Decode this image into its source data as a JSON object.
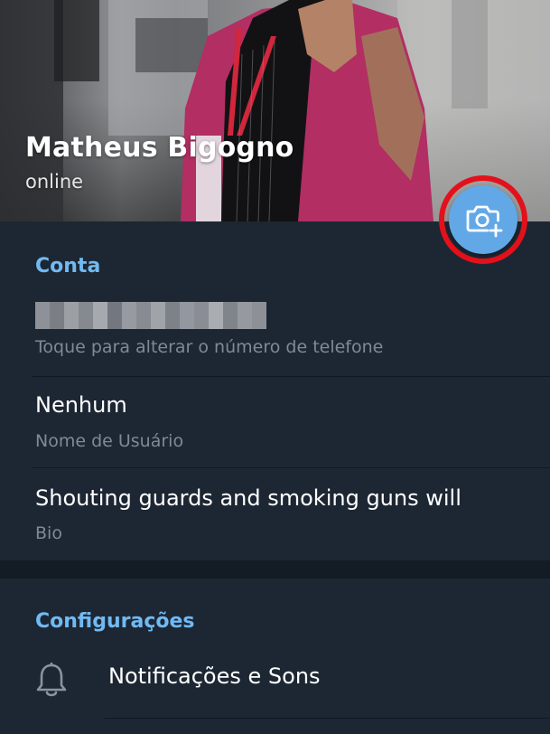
{
  "profile": {
    "name": "Matheus Bigogno",
    "status": "online"
  },
  "camera_button": {
    "icon": "camera-add-icon",
    "accent": "#62a8e7",
    "highlight_color": "#e3111c"
  },
  "account_section": {
    "title": "Conta",
    "phone": {
      "value": "",
      "hint": "Toque para alterar o número de telefone"
    },
    "username": {
      "value": "Nenhum",
      "hint": "Nome de Usuário"
    },
    "bio": {
      "value": "Shouting guards and smoking guns will",
      "hint": "Bio"
    }
  },
  "settings_section": {
    "title": "Configurações",
    "items": [
      {
        "icon": "bell-icon",
        "label": "Notificações e Sons"
      }
    ]
  },
  "colors": {
    "background": "#1d2733",
    "section_title": "#71baf3",
    "primary_text": "#ffffff",
    "secondary_text": "#7f8a97"
  }
}
